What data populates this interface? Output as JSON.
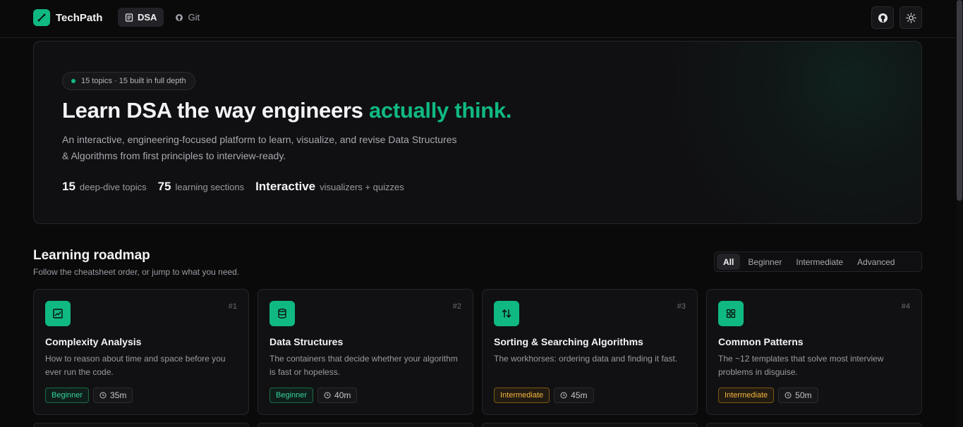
{
  "header": {
    "brand": "TechPath",
    "nav": [
      {
        "label": "DSA",
        "active": true
      },
      {
        "label": "Git",
        "active": false
      }
    ]
  },
  "hero": {
    "pill": "15 topics · 15 built in full depth",
    "title_main": "Learn DSA the way engineers ",
    "title_accent": "actually think.",
    "description": "An interactive, engineering-focused platform to learn, visualize, and revise Data Structures & Algorithms from first principles to interview-ready.",
    "stats": [
      {
        "value": "15",
        "label": "deep-dive topics"
      },
      {
        "value": "75",
        "label": "learning sections"
      },
      {
        "value": "Interactive",
        "label": "visualizers + quizzes"
      }
    ]
  },
  "roadmap": {
    "title": "Learning roadmap",
    "subtitle": "Follow the cheatsheet order, or jump to what you need.",
    "filters": [
      {
        "label": "All",
        "active": true
      },
      {
        "label": "Beginner",
        "active": false
      },
      {
        "label": "Intermediate",
        "active": false
      },
      {
        "label": "Advanced",
        "active": false
      }
    ],
    "cards": [
      {
        "num": "#1",
        "title": "Complexity Analysis",
        "desc": "How to reason about time and space before you ever run the code.",
        "level": "Beginner",
        "time": "35m",
        "icon": "chart-icon"
      },
      {
        "num": "#2",
        "title": "Data Structures",
        "desc": "The containers that decide whether your algorithm is fast or hopeless.",
        "level": "Beginner",
        "time": "40m",
        "icon": "database-icon"
      },
      {
        "num": "#3",
        "title": "Sorting & Searching Algorithms",
        "desc": "The workhorses: ordering data and finding it fast.",
        "level": "Intermediate",
        "time": "45m",
        "icon": "arrows-up-down-icon"
      },
      {
        "num": "#4",
        "title": "Common Patterns",
        "desc": "The ~12 templates that solve most interview problems in disguise.",
        "level": "Intermediate",
        "time": "50m",
        "icon": "grid-icon"
      }
    ]
  },
  "colors": {
    "accent": "#10b981",
    "beginner": "#34d399",
    "intermediate": "#f4b63f",
    "background": "#0a0a0b"
  }
}
